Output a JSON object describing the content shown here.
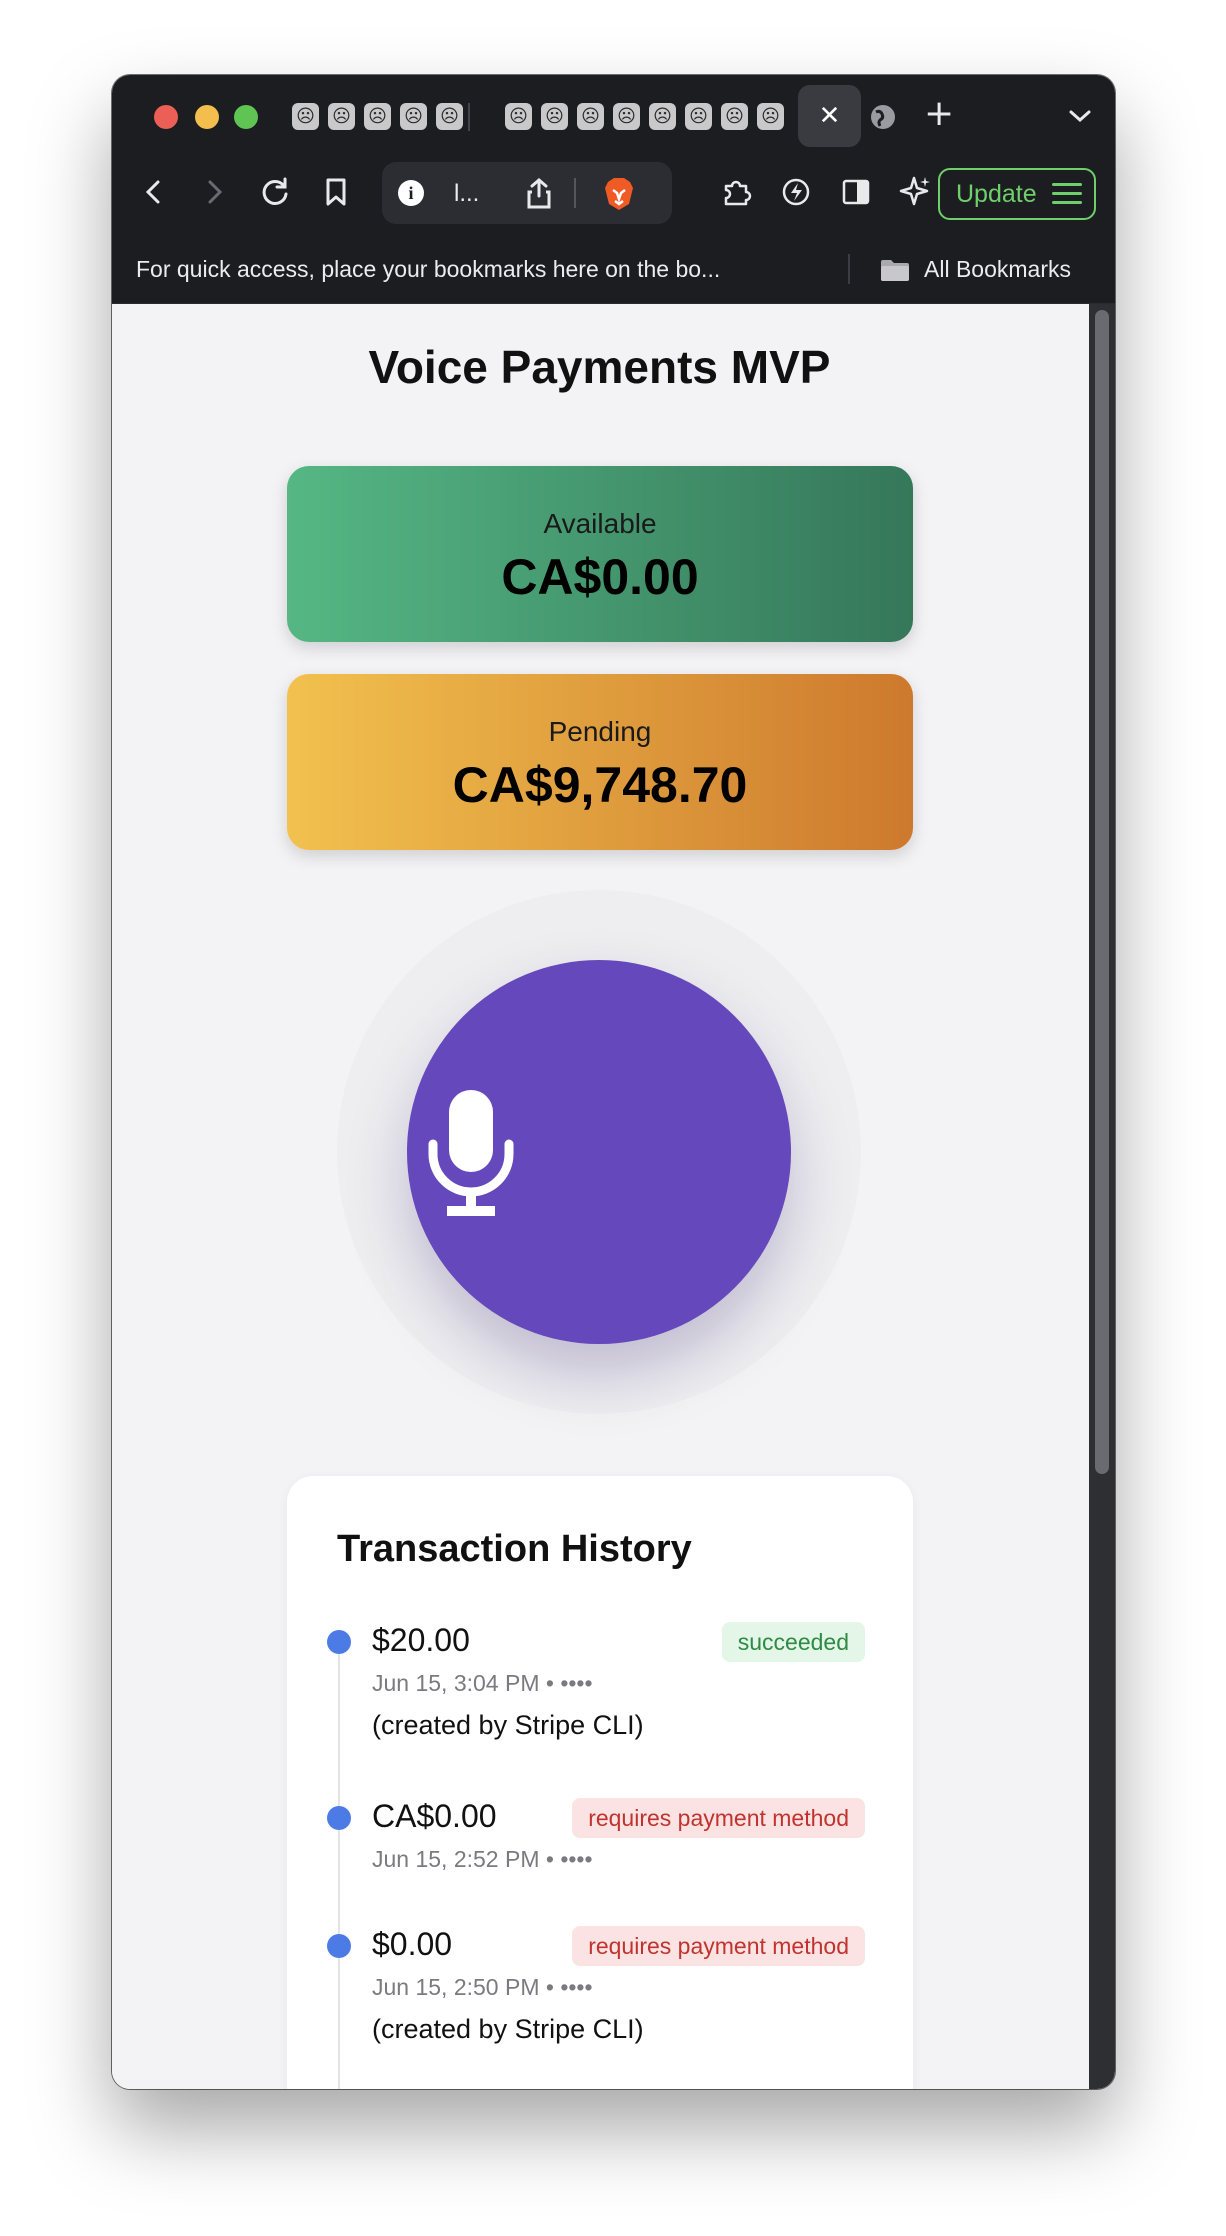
{
  "browser": {
    "tab_favicon_glyph": "☹",
    "new_tab_glyph": "+",
    "close_tab_glyph": "✕",
    "tabs_menu_glyph": "⌄",
    "url_text": "l...",
    "update_label": "Update"
  },
  "bookmarks_bar": {
    "hint": "For quick access, place your bookmarks here on the bo...",
    "all_bookmarks_label": "All Bookmarks"
  },
  "page": {
    "title": "Voice Payments MVP",
    "available": {
      "label": "Available",
      "value": "CA$0.00"
    },
    "pending": {
      "label": "Pending",
      "value": "CA$9,748.70"
    },
    "history": {
      "title": "Transaction History",
      "items": [
        {
          "amount": "$20.00",
          "status": "succeeded",
          "meta": "Jun 15, 3:04 PM • ••••",
          "description": "(created by Stripe CLI)"
        },
        {
          "amount": "CA$0.00",
          "status": "requires payment method",
          "meta": "Jun 15, 2:52 PM • ••••",
          "description": ""
        },
        {
          "amount": "$0.00",
          "status": "requires payment method",
          "meta": "Jun 15, 2:50 PM • ••••",
          "description": "(created by Stripe CLI)"
        }
      ]
    }
  },
  "colors": {
    "accent_purple": "#6548bb",
    "available_gradient": [
      "#55b784",
      "#35775a"
    ],
    "pending_gradient": [
      "#f2c14e",
      "#cd792d"
    ],
    "dot_blue": "#4c7be6",
    "success_green": "#2f8a45",
    "warning_red": "#c0332e"
  },
  "icons": [
    "microphone-icon",
    "back-icon",
    "forward-icon",
    "reload-icon",
    "bookmark-icon",
    "info-icon",
    "share-icon",
    "brave-lion-icon",
    "extensions-icon",
    "leo-icon",
    "sidebar-icon",
    "ai-sparkle-icon",
    "menu-icon",
    "folder-icon",
    "globe-icon"
  ]
}
